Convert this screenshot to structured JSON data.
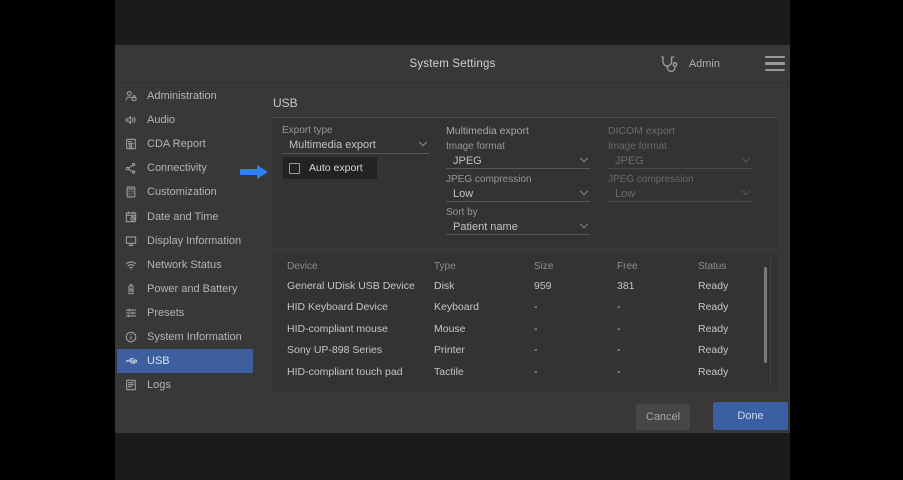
{
  "header": {
    "title": "System Settings",
    "user": "Admin",
    "user_icon": "stethoscope-icon",
    "menu_icon": "hamburger-menu-icon"
  },
  "sidebar": {
    "items": [
      {
        "id": "administration",
        "label": "Administration",
        "icon": "user-icon",
        "selected": false
      },
      {
        "id": "audio",
        "label": "Audio",
        "icon": "speaker-icon",
        "selected": false
      },
      {
        "id": "cda-report",
        "label": "CDA Report",
        "icon": "report-document-icon",
        "selected": false
      },
      {
        "id": "connectivity",
        "label": "Connectivity",
        "icon": "network-nodes-icon",
        "selected": false
      },
      {
        "id": "customization",
        "label": "Customization",
        "icon": "customization-icon",
        "selected": false
      },
      {
        "id": "date-and-time",
        "label": "Date and Time",
        "icon": "calendar-clock-icon",
        "selected": false
      },
      {
        "id": "display-information",
        "label": "Display Information",
        "icon": "monitor-icon",
        "selected": false
      },
      {
        "id": "network-status",
        "label": "Network Status",
        "icon": "wifi-icon",
        "selected": false
      },
      {
        "id": "power-and-battery",
        "label": "Power and Battery",
        "icon": "battery-icon",
        "selected": false
      },
      {
        "id": "presets",
        "label": "Presets",
        "icon": "sliders-icon",
        "selected": false
      },
      {
        "id": "system-information",
        "label": "System Information",
        "icon": "info-icon",
        "selected": false
      },
      {
        "id": "usb",
        "label": "USB",
        "icon": "usb-icon",
        "selected": true
      },
      {
        "id": "logs",
        "label": "Logs",
        "icon": "logs-document-icon",
        "selected": false
      }
    ]
  },
  "main": {
    "title": "USB",
    "export_type": {
      "label": "Export type",
      "value": "Multimedia export",
      "auto_export_label": "Auto export",
      "auto_export_checked": false
    },
    "multimedia_export": {
      "title": "Multimedia export",
      "disabled": false,
      "fields": [
        {
          "id": "image-format",
          "label": "Image format",
          "value": "JPEG"
        },
        {
          "id": "jpeg-compression",
          "label": "JPEG compression",
          "value": "Low"
        },
        {
          "id": "sort-by",
          "label": "Sort by",
          "value": "Patient name"
        }
      ]
    },
    "dicom_export": {
      "title": "DICOM export",
      "disabled": true,
      "fields": [
        {
          "id": "image-format",
          "label": "Image format",
          "value": "JPEG"
        },
        {
          "id": "jpeg-compression",
          "label": "JPEG compression",
          "value": "Low"
        }
      ]
    },
    "device_table": {
      "columns": [
        "Device",
        "Type",
        "Size",
        "Free",
        "Status"
      ],
      "rows": [
        [
          "General UDisk USB Device",
          "Disk",
          "959",
          "381",
          "Ready"
        ],
        [
          "HID Keyboard Device",
          "Keyboard",
          "-",
          "-",
          "Ready"
        ],
        [
          "HID-compliant mouse",
          "Mouse",
          "-",
          "-",
          "Ready"
        ],
        [
          "Sony UP-898 Series",
          "Printer",
          "-",
          "-",
          "Ready"
        ],
        [
          "HID-compliant touch pad",
          "Tactile",
          "-",
          "-",
          "Ready"
        ]
      ]
    }
  },
  "footer": {
    "cancel_label": "Cancel",
    "done_label": "Done"
  },
  "colors": {
    "selected_item_blue": "#3d5f9e",
    "done_button_blue": "#3b5fa2",
    "pointer_arrow_blue": "#2f80f2",
    "window_background": "#383838",
    "panel_background": "#333333",
    "letterbox_background": "#1b1b1b"
  }
}
